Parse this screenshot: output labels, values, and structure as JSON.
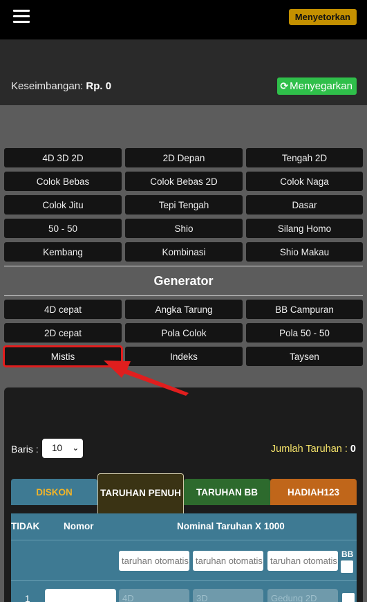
{
  "header": {
    "deposit_label": "Menyetorkan"
  },
  "balance": {
    "label": "Keseimbangan: ",
    "value": "Rp. 0",
    "refresh_label": "Menyegarkan"
  },
  "games": [
    [
      "4D 3D 2D",
      "2D Depan",
      "Tengah 2D"
    ],
    [
      "Colok Bebas",
      "Colok Bebas 2D",
      "Colok Naga"
    ],
    [
      "Colok Jitu",
      "Tepi Tengah",
      "Dasar"
    ],
    [
      "50 - 50",
      "Shio",
      "Silang Homo"
    ],
    [
      "Kembang",
      "Kombinasi",
      "Shio Makau"
    ]
  ],
  "generator": {
    "title": "Generator",
    "items": [
      [
        "4D cepat",
        "Angka Tarung",
        "BB Campuran"
      ],
      [
        "2D cepat",
        "Pola Colok",
        "Pola 50 - 50"
      ],
      [
        "Mistis",
        "Indeks",
        "Taysen"
      ]
    ],
    "highlighted": "Mistis"
  },
  "bet_form": {
    "rows_label": "Baris :",
    "rows_value": "10",
    "total_label": "Jumlah Taruhan : ",
    "total_value": "0",
    "tabs": [
      "DISKON",
      "TARUHAN PENUH",
      "TARUHAN BB",
      "HADIAH123"
    ],
    "columns": [
      "TIDAK",
      "Nomor",
      "Nominal Taruhan X 1000"
    ],
    "auto_placeholder": "taruhan otomatis",
    "bb_label": "BB",
    "rows": [
      {
        "no": "1",
        "placeholders": [
          "4D",
          "3D",
          "Gedung 2D"
        ]
      }
    ]
  },
  "colors": {
    "accent_gold": "#c49000",
    "refresh_green": "#2fbf4a",
    "table_teal": "#3e7a93",
    "highlight_red": "#e01e1e"
  }
}
